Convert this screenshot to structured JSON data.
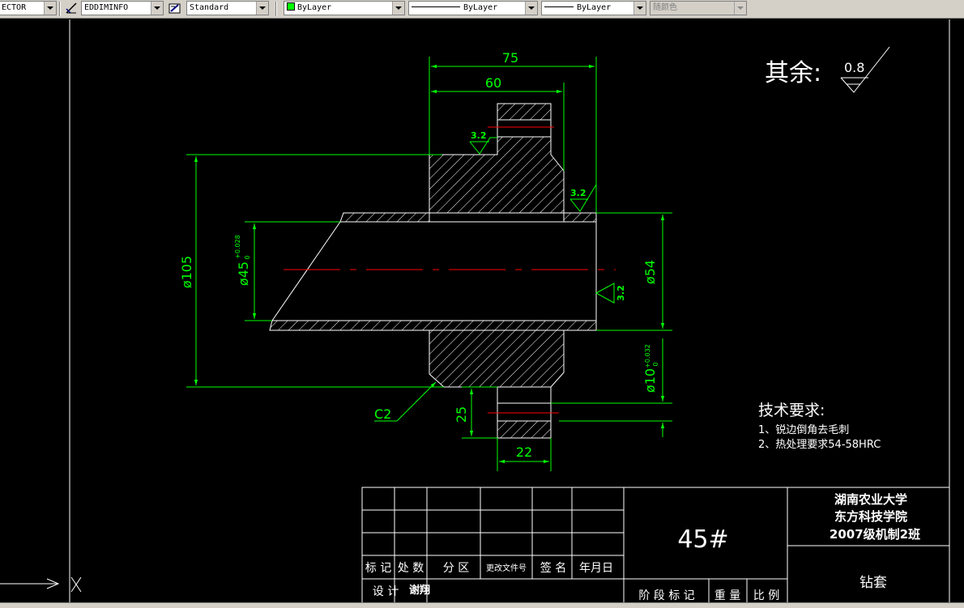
{
  "toolbar": {
    "plot_style": "ECTOR",
    "dimstyle": "EDDIMINFO",
    "textstyle": "Standard",
    "layer": "ByLayer",
    "linetype": "ByLayer",
    "lineweight": "ByLayer",
    "plotstyle": "随颜色"
  },
  "drawing": {
    "roughness_label": "其余:",
    "roughness_value": "0.8",
    "dims": {
      "d75": "75",
      "d60": "60",
      "d105": "ø105",
      "d45": "ø45",
      "d45_tol_upper": "+0.028",
      "d45_tol_lower": "0",
      "d54": "ø54",
      "d10": "ø10",
      "d10_tol_upper": "+0.032",
      "d10_tol_lower": "0",
      "d25": "25",
      "d22": "22",
      "chamfer": "C2",
      "ra_a": "3.2",
      "ra_b": "3.2",
      "ra_c": "3.2"
    },
    "tech_title": "技术要求:",
    "tech_items": [
      "1、锐边倒角去毛刺",
      "2、热处理要求54-58HRC"
    ]
  },
  "title_block": {
    "school": "湖南农业大学",
    "college": "东方科技学院",
    "class_name": "2007级机制2班",
    "material": "45#",
    "part_name": "钻套",
    "row_labels": [
      "标 记",
      "处 数",
      "分 区",
      "更改文件号",
      "签 名",
      "年月日"
    ],
    "design_label": "设 计",
    "designer": "谢翔",
    "stage_labels": [
      "阶 段 标 记",
      "重 量",
      "比 例"
    ]
  },
  "colors": {
    "background": "#000000",
    "geometry": "#ffffff",
    "dimension": "#00ff00",
    "centerline": "#ff0000"
  }
}
